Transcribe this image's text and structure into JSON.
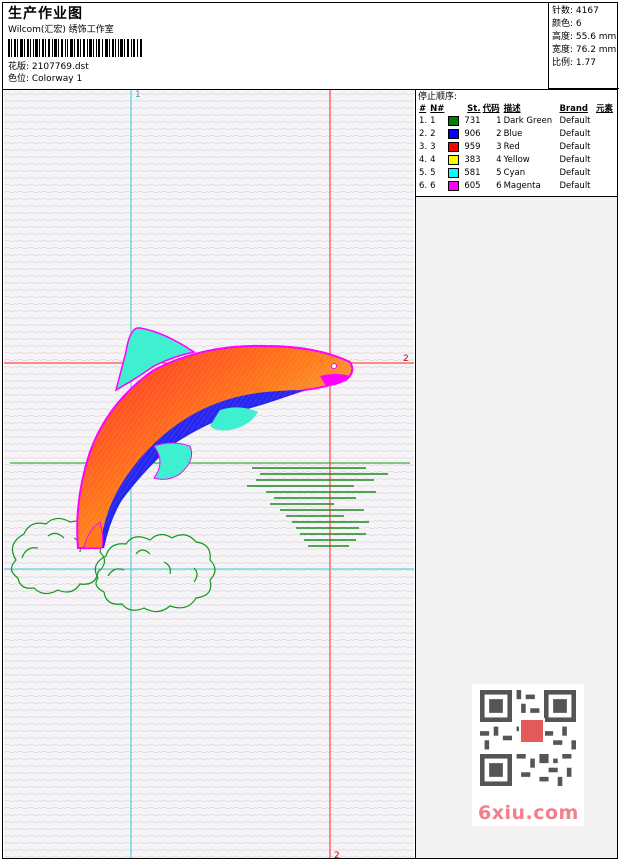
{
  "header": {
    "title": "生产作业图",
    "subtitle": "Wilcom(汇宏) 绣饰工作室",
    "design_line": "花版: 2107769.dst",
    "colorway_line": "色位: Colorway 1"
  },
  "stats": {
    "stitches": "针数: 4167",
    "colors": "颜色: 6",
    "height": "高度: 55.6 mm",
    "width": "宽度: 76.2 mm",
    "scale": "比例: 1.77"
  },
  "stop_sequence": {
    "title": "停止顺序:",
    "headers": [
      "#",
      "N#",
      "St.",
      "代码",
      "描述",
      "Brand",
      "元素"
    ],
    "rows": [
      {
        "num": "1.",
        "needle": "1",
        "st": "731",
        "code": "1",
        "desc": "Dark Green",
        "brand": "Default",
        "color": "#008000"
      },
      {
        "num": "2.",
        "needle": "2",
        "st": "906",
        "code": "2",
        "desc": "Blue",
        "brand": "Default",
        "color": "#0000ff"
      },
      {
        "num": "3.",
        "needle": "3",
        "st": "959",
        "code": "3",
        "desc": "Red",
        "brand": "Default",
        "color": "#ff0000"
      },
      {
        "num": "4.",
        "needle": "4",
        "st": "383",
        "code": "4",
        "desc": "Yellow",
        "brand": "Default",
        "color": "#ffff00"
      },
      {
        "num": "5.",
        "needle": "5",
        "st": "581",
        "code": "5",
        "desc": "Cyan",
        "brand": "Default",
        "color": "#00ffff"
      },
      {
        "num": "6.",
        "needle": "6",
        "st": "605",
        "code": "6",
        "desc": "Magenta",
        "brand": "Default",
        "color": "#ff00ff"
      }
    ]
  },
  "guides": {
    "v1_label": "1",
    "h2_label": "2",
    "v2_label": "2"
  },
  "watermark": {
    "site": "6xiu.com"
  }
}
